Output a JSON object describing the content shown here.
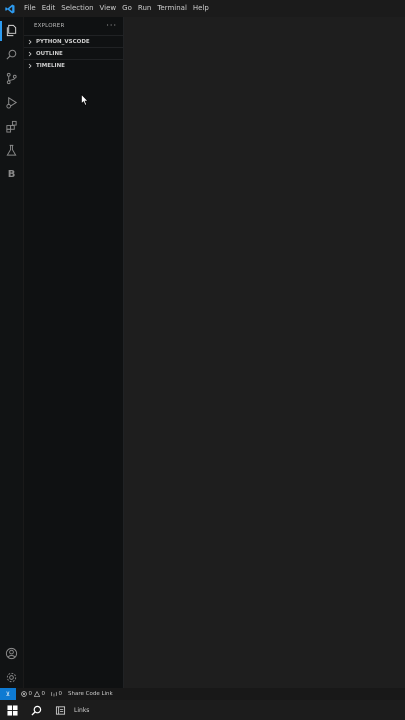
{
  "menu": [
    "File",
    "Edit",
    "Selection",
    "View",
    "Go",
    "Run",
    "Terminal",
    "Help"
  ],
  "activity_bar": {
    "icons": [
      "explorer-icon",
      "search-icon",
      "source-control-icon",
      "run-debug-icon",
      "extensions-icon",
      "testing-icon",
      "b-icon"
    ],
    "b_label": "B",
    "bottom_icons": [
      "accounts-icon",
      "manage-gear-icon"
    ]
  },
  "sidebar": {
    "title": "EXPLORER",
    "more": "···",
    "sections": [
      {
        "label": "PYTHON_VSCODE"
      },
      {
        "label": "OUTLINE"
      },
      {
        "label": "TIMELINE"
      }
    ]
  },
  "statusbar": {
    "remote": "⊻",
    "errors": "0",
    "warnings": "0",
    "ports": "0",
    "share": "Share Code Link"
  },
  "taskbar": {
    "label": "Links"
  },
  "colors": {
    "accent": "#2d9bf0",
    "remote_bg": "#0e7ad2",
    "sidebar_bg": "#0f1112",
    "editor_bg": "#1e1e1e"
  }
}
